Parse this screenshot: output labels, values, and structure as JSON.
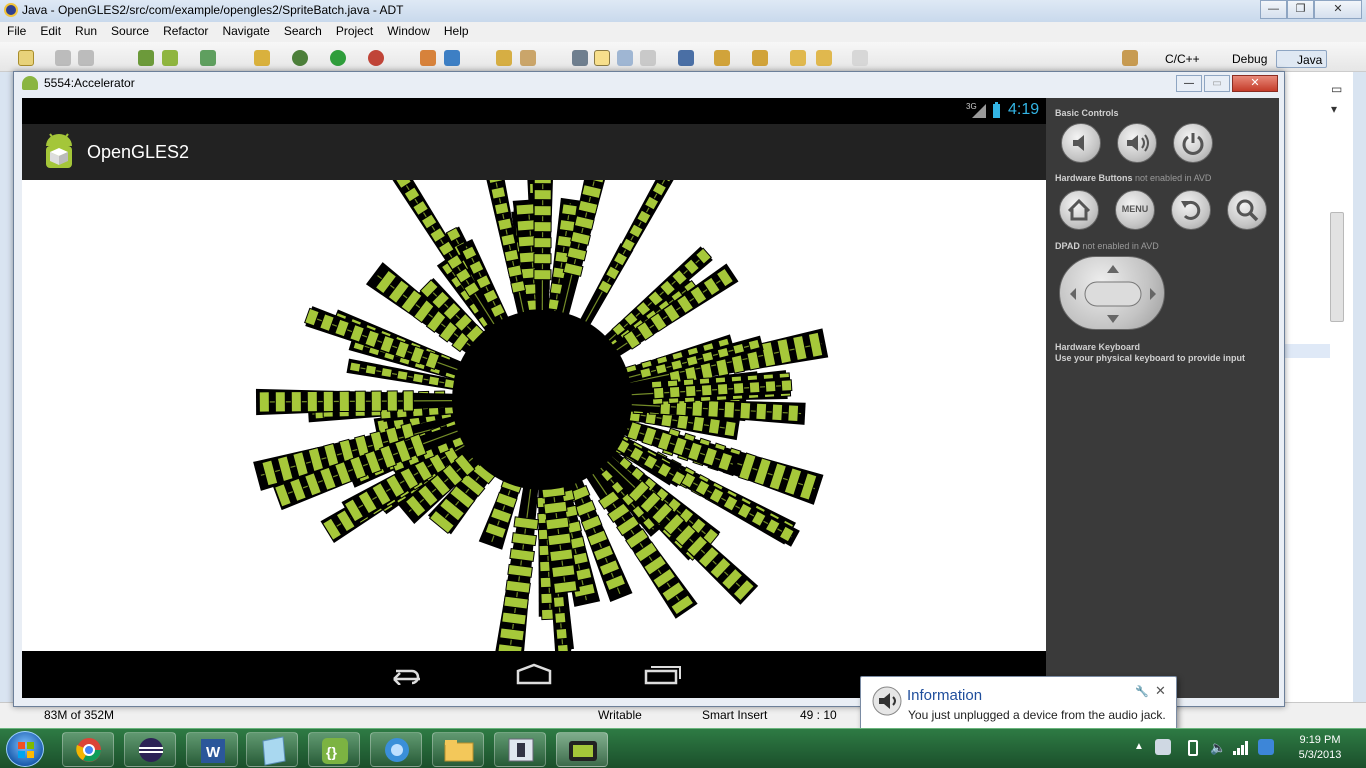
{
  "window": {
    "title": "Java - OpenGLES2/src/com/example/opengles2/SpriteBatch.java - ADT",
    "min": "—",
    "max": "❐",
    "close": "✕"
  },
  "menu": [
    "File",
    "Edit",
    "Run",
    "Source",
    "Refactor",
    "Navigate",
    "Search",
    "Project",
    "Window",
    "Help"
  ],
  "perspectives": {
    "cpp": "C/C++",
    "debug": "Debug",
    "java": "Java"
  },
  "eclipse_status": {
    "heap": "83M of 352M",
    "writable": "Writable",
    "insert": "Smart Insert",
    "position": "49 : 10"
  },
  "emulator": {
    "title": "5554:Accelerator",
    "android_status": {
      "network": "3G",
      "clock": "4:19"
    },
    "app_title": "OpenGLES2",
    "controls": {
      "basic": "Basic Controls",
      "hardware_title": "Hardware Buttons",
      "hardware_note": "not enabled in AVD",
      "menu_label": "MENU",
      "dpad_title": "DPAD",
      "dpad_note": "not enabled in AVD",
      "keyboard_title": "Hardware Keyboard",
      "keyboard_note": "Use your physical keyboard to provide input"
    }
  },
  "notification": {
    "title": "Information",
    "message": "You just unplugged a device from the audio jack."
  },
  "tray": {
    "time": "9:19 PM",
    "date": "5/3/2013"
  },
  "taskbar_apps": [
    "chrome-icon",
    "eclipse-icon",
    "word-icon",
    "notepad-icon",
    "brackets-icon",
    "itunes-icon",
    "explorer-icon",
    "device-manager-icon",
    "android-emulator-icon"
  ],
  "colors": {
    "sprite_green": "#a6c83a",
    "android_blue": "#33b5e5"
  }
}
